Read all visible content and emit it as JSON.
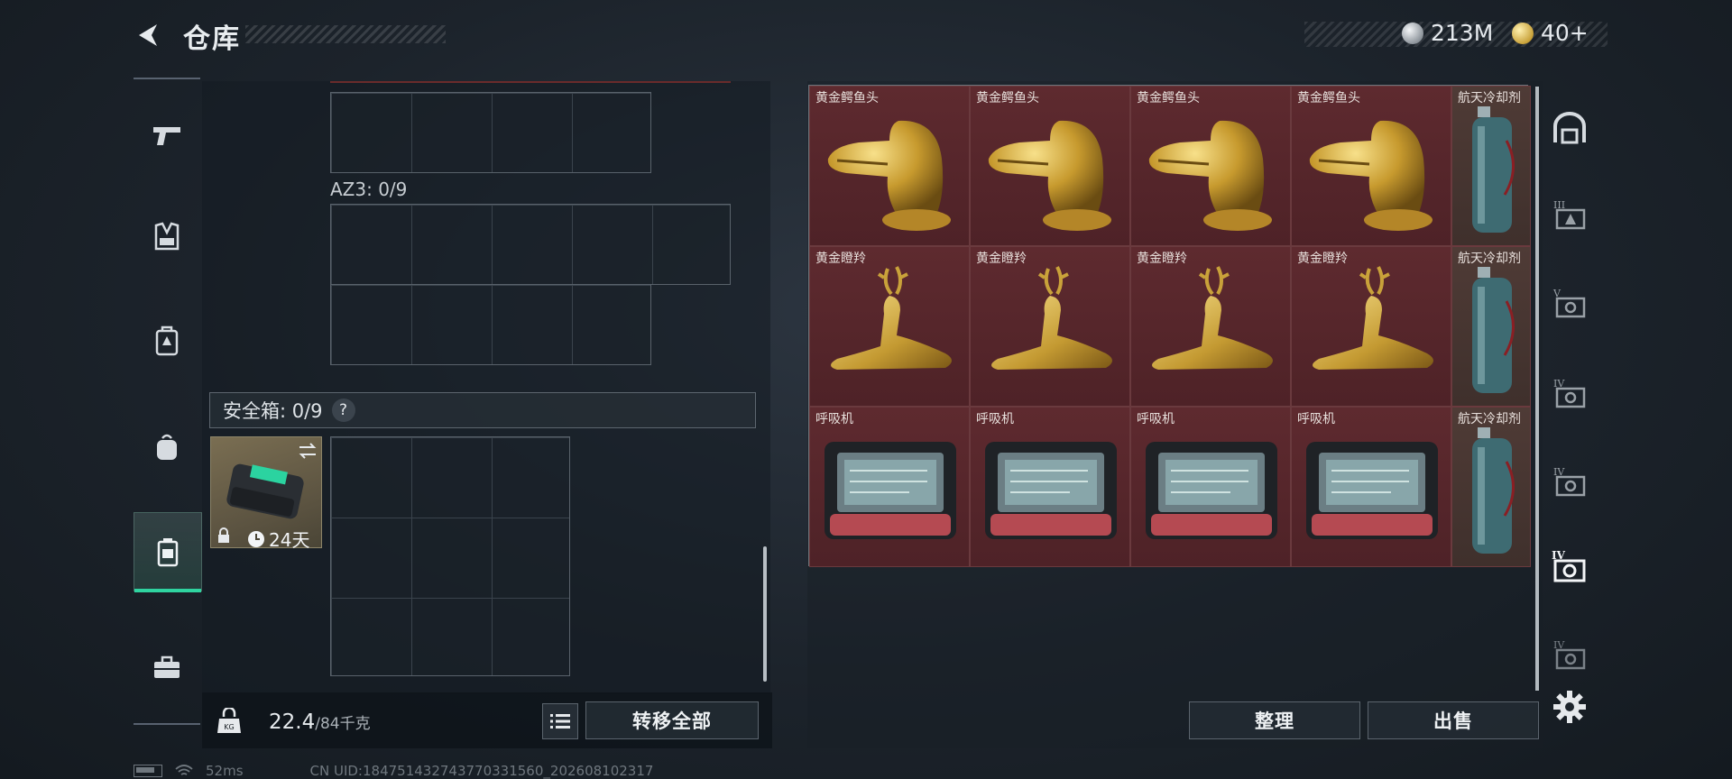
{
  "header": {
    "title": "仓库",
    "currency_silver": "213M",
    "currency_gold": "40+"
  },
  "sidebar": {
    "items": [
      {
        "icon": "pistol-icon",
        "active": false
      },
      {
        "icon": "vest-icon",
        "active": false
      },
      {
        "icon": "rig-icon",
        "active": false
      },
      {
        "icon": "backpack-icon",
        "active": false
      },
      {
        "icon": "safe-case-icon",
        "active": true
      },
      {
        "icon": "toolbox-icon",
        "active": false
      }
    ]
  },
  "left_panel": {
    "az3_label": "AZ3: 0/9",
    "safe_label": "安全箱: 0/9",
    "help": "?",
    "safe_item": {
      "timer": "24天",
      "icon": "lock-icon"
    },
    "weight_current": "22.4",
    "weight_max": "/84千克",
    "transfer_all": "转移全部"
  },
  "storage": {
    "items": [
      {
        "label": "黄金鳄鱼头",
        "kind": "croc-head"
      },
      {
        "label": "黄金鳄鱼头",
        "kind": "croc-head"
      },
      {
        "label": "黄金鳄鱼头",
        "kind": "croc-head"
      },
      {
        "label": "黄金鳄鱼头",
        "kind": "croc-head"
      },
      {
        "label": "黄金瞪羚",
        "kind": "gazelle"
      },
      {
        "label": "黄金瞪羚",
        "kind": "gazelle"
      },
      {
        "label": "黄金瞪羚",
        "kind": "gazelle"
      },
      {
        "label": "黄金瞪羚",
        "kind": "gazelle"
      },
      {
        "label": "呼吸机",
        "kind": "ventilator"
      },
      {
        "label": "呼吸机",
        "kind": "ventilator"
      },
      {
        "label": "呼吸机",
        "kind": "ventilator"
      },
      {
        "label": "呼吸机",
        "kind": "ventilator"
      }
    ],
    "tall_items": [
      {
        "label": "航天冷却剂"
      },
      {
        "label": "航天冷却剂"
      },
      {
        "label": "航天冷却剂"
      }
    ],
    "sort_button": "整理",
    "sell_button": "出售"
  },
  "right_rail": {
    "icons": [
      "arch-icon",
      "tier-iii-crate-icon",
      "tier-v-crate-icon",
      "tier-iv-crate-icon",
      "tier-iv-crate-icon",
      "tier-iv-crate-icon-active",
      "tier-iv-crate-icon"
    ]
  },
  "status": {
    "ping": "52ms",
    "uid": "CN UID:184751432743770331560_202608102317"
  }
}
